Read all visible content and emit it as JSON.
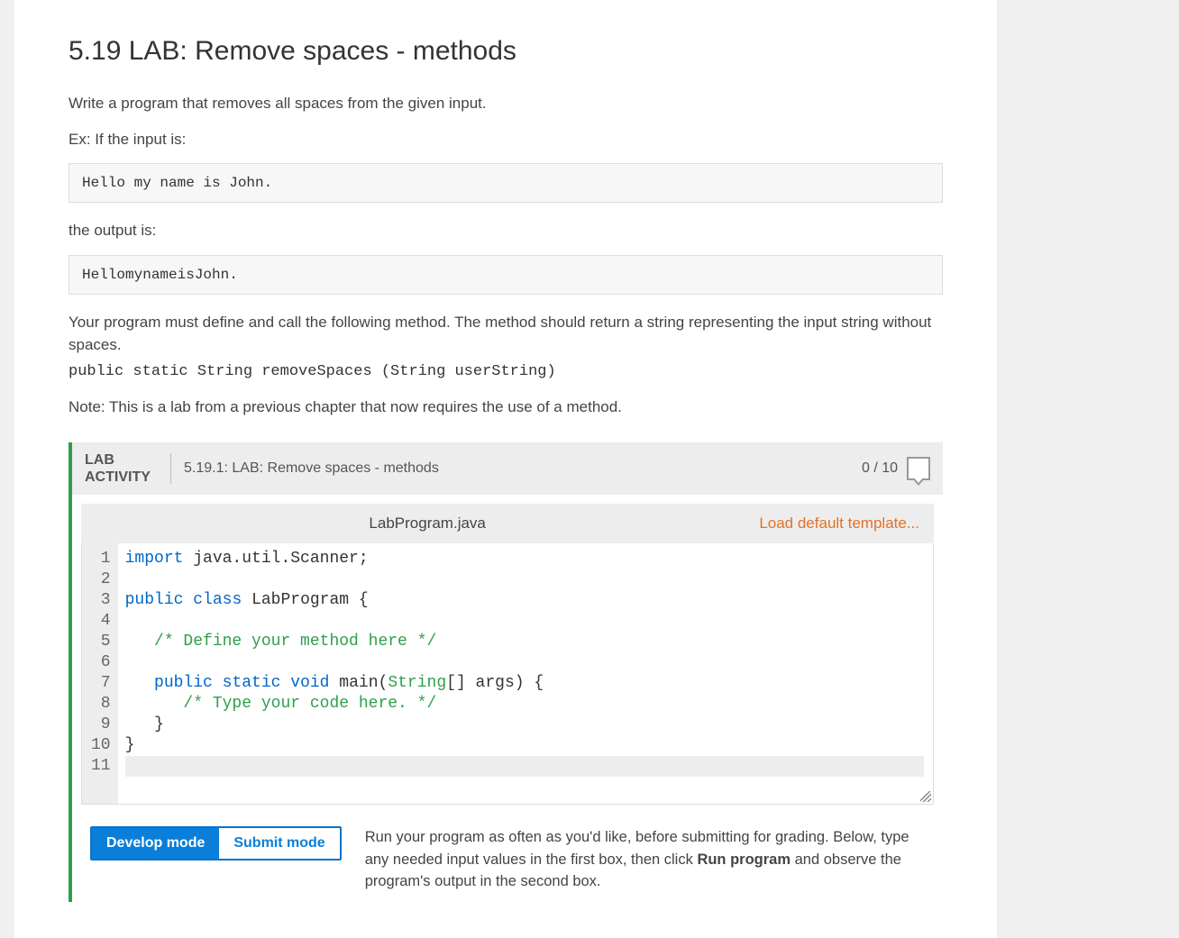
{
  "title": "5.19 LAB: Remove spaces - methods",
  "intro": "Write a program that removes all spaces from the given input.",
  "ex_label": "Ex: If the input is:",
  "example_input": "Hello my name is John.",
  "output_label": "the output is:",
  "example_output": "HellomynameisJohn.",
  "method_desc": "Your program must define and call the following method. The method should return a string representing the input string without spaces.",
  "method_sig": "public static String removeSpaces (String userString)",
  "note": "Note: This is a lab from a previous chapter that now requires the use of a method.",
  "lab": {
    "tag_line1": "LAB",
    "tag_line2": "ACTIVITY",
    "title": "5.19.1: LAB: Remove spaces - methods",
    "score": "0 / 10",
    "filename": "LabProgram.java",
    "load_template": "Load default template..."
  },
  "code": {
    "lines": [
      {
        "n": 1,
        "html": "<span class=\"kw\">import</span> java.util.Scanner;"
      },
      {
        "n": 2,
        "html": ""
      },
      {
        "n": 3,
        "html": "<span class=\"kw\">public</span> <span class=\"kw\">class</span> <span class=\"fn\">LabProgram</span> {"
      },
      {
        "n": 4,
        "html": ""
      },
      {
        "n": 5,
        "html": "   <span class=\"cm\">/* Define your method here */</span>"
      },
      {
        "n": 6,
        "html": ""
      },
      {
        "n": 7,
        "html": "   <span class=\"kw\">public</span> <span class=\"kw\">static</span> <span class=\"kw\">void</span> <span class=\"fn\">main</span>(<span class=\"ty\">String</span>[] args) {"
      },
      {
        "n": 8,
        "html": "      <span class=\"cm\">/* Type your code here. */</span>"
      },
      {
        "n": 9,
        "html": "   }"
      },
      {
        "n": 10,
        "html": "}"
      },
      {
        "n": 11,
        "html": "<span class=\"curline\"> </span>"
      }
    ]
  },
  "modes": {
    "develop": "Develop mode",
    "submit": "Submit mode",
    "desc_pre": "Run your program as often as you'd like, before submitting for grading. Below, type any needed input values in the first box, then click ",
    "desc_bold": "Run program",
    "desc_post": " and observe the program's output in the second box."
  }
}
